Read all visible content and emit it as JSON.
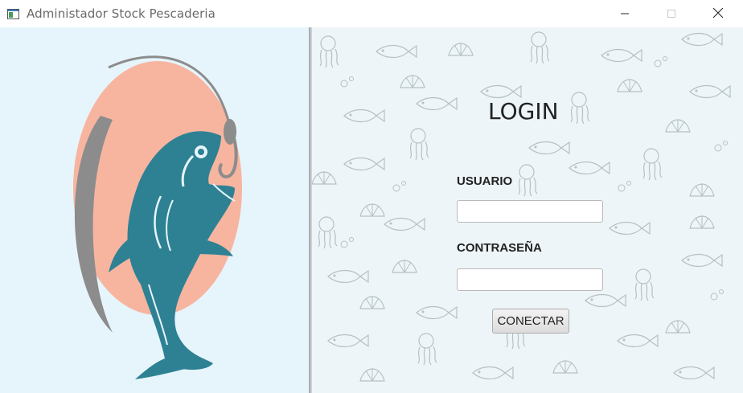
{
  "window": {
    "title": "Administador Stock Pescaderia",
    "icons": {
      "app": "window-app-icon",
      "minimize": "minimize-icon",
      "maximize": "maximize-icon",
      "close": "close-icon"
    }
  },
  "logo": {
    "icon": "fish-logo-icon",
    "colors": {
      "fish": "#2e8193",
      "circle": "#f7b5a0",
      "line": "#8c8c8c"
    }
  },
  "login": {
    "title": "LOGIN",
    "user_label": "USUARIO",
    "user_value": "",
    "pass_label": "CONTRASEÑA",
    "pass_value": "",
    "connect_label": "CONECTAR"
  },
  "background": {
    "pattern": "seafood-doodle-pattern",
    "color": "#eef5f8"
  }
}
